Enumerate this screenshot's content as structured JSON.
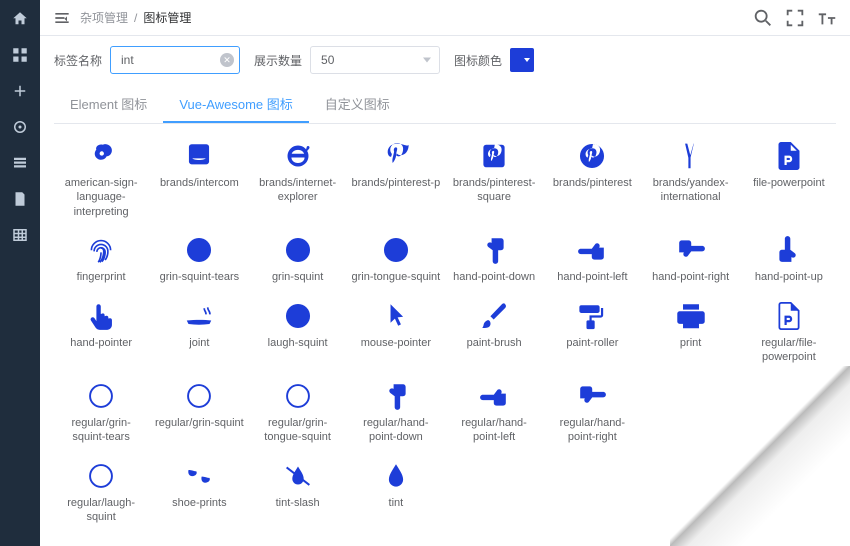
{
  "breadcrumb": {
    "part1": "杂项管理",
    "sep": "/",
    "part2": "图标管理"
  },
  "filters": {
    "label_name": "标签名称",
    "search_value": "int",
    "display_count_label": "展示数量",
    "display_count_value": "50",
    "icon_color_label": "图标颜色"
  },
  "tabs": {
    "element": "Element 图标",
    "vue": "Vue-Awesome 图标",
    "custom": "自定义图标"
  },
  "icons": [
    {
      "name": "american-sign-language-interpreting",
      "svg": "asl"
    },
    {
      "name": "brands/intercom",
      "svg": "intercom"
    },
    {
      "name": "brands/internet-explorer",
      "svg": "ie"
    },
    {
      "name": "brands/pinterest-p",
      "svg": "pinterest-p"
    },
    {
      "name": "brands/pinterest-square",
      "svg": "pinterest-sq"
    },
    {
      "name": "brands/pinterest",
      "svg": "pinterest"
    },
    {
      "name": "brands/yandex-international",
      "svg": "yandex"
    },
    {
      "name": "file-powerpoint",
      "svg": "file-ppt"
    },
    {
      "name": "fingerprint",
      "svg": "fingerprint"
    },
    {
      "name": "grin-squint-tears",
      "svg": "grin-squint-tears"
    },
    {
      "name": "grin-squint",
      "svg": "grin-squint"
    },
    {
      "name": "grin-tongue-squint",
      "svg": "grin-tongue"
    },
    {
      "name": "hand-point-down",
      "svg": "hand-down"
    },
    {
      "name": "hand-point-left",
      "svg": "hand-left"
    },
    {
      "name": "hand-point-right",
      "svg": "hand-right"
    },
    {
      "name": "hand-point-up",
      "svg": "hand-up"
    },
    {
      "name": "hand-pointer",
      "svg": "hand-pointer"
    },
    {
      "name": "joint",
      "svg": "joint"
    },
    {
      "name": "laugh-squint",
      "svg": "laugh-squint"
    },
    {
      "name": "mouse-pointer",
      "svg": "mouse-pointer"
    },
    {
      "name": "paint-brush",
      "svg": "paint-brush"
    },
    {
      "name": "paint-roller",
      "svg": "paint-roller"
    },
    {
      "name": "print",
      "svg": "print"
    },
    {
      "name": "regular/file-powerpoint",
      "svg": "file-ppt-o"
    },
    {
      "name": "regular/grin-squint-tears",
      "svg": "grin-squint-tears-o"
    },
    {
      "name": "regular/grin-squint",
      "svg": "grin-squint-o"
    },
    {
      "name": "regular/grin-tongue-squint",
      "svg": "grin-tongue-o"
    },
    {
      "name": "regular/hand-point-down",
      "svg": "hand-down-o"
    },
    {
      "name": "regular/hand-point-left",
      "svg": "hand-left-o"
    },
    {
      "name": "regular/hand-point-right",
      "svg": "hand-right-o"
    },
    {
      "name": "",
      "svg": ""
    },
    {
      "name": "",
      "svg": ""
    },
    {
      "name": "regular/laugh-squint",
      "svg": "laugh-squint-o"
    },
    {
      "name": "shoe-prints",
      "svg": "shoe-prints"
    },
    {
      "name": "tint-slash",
      "svg": "tint-slash"
    },
    {
      "name": "tint",
      "svg": "tint"
    }
  ]
}
